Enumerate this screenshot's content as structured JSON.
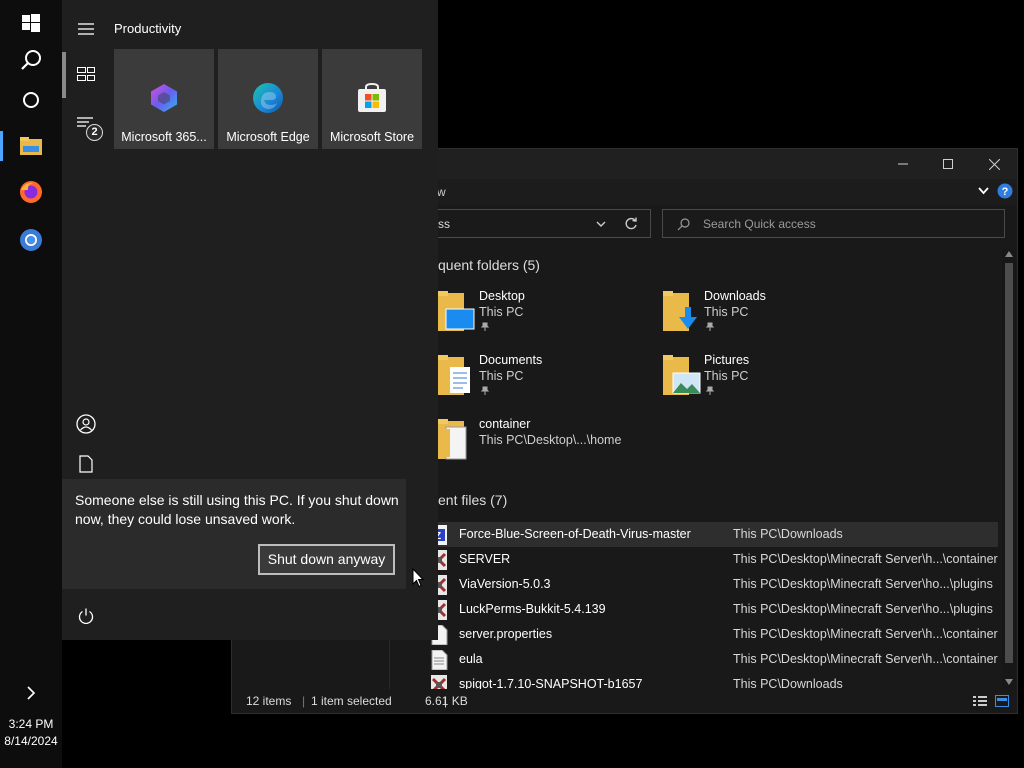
{
  "taskbar": {
    "clock_time": "3:24 PM",
    "clock_date": "8/14/2024"
  },
  "start_menu": {
    "group_title": "Productivity",
    "badge_count": "2",
    "tiles": [
      {
        "label": "Microsoft 365...",
        "icon": "microsoft-365-icon"
      },
      {
        "label": "Microsoft Edge",
        "icon": "edge-icon"
      },
      {
        "label": "Microsoft Store",
        "icon": "store-icon"
      }
    ]
  },
  "notice": {
    "message": "Someone else is still using this PC. If you shut down now, they could lose unsaved work.",
    "button_label": "Shut down anyway"
  },
  "explorer": {
    "ribbon_fragment": "w",
    "address_fragment": "ss",
    "search_placeholder": "Search Quick access",
    "frequent_header": "quent folders (5)",
    "recent_header": "ent files (7)",
    "folders": [
      {
        "name": "Desktop",
        "location": "This PC",
        "pinned": true
      },
      {
        "name": "Downloads",
        "location": "This PC",
        "pinned": true
      },
      {
        "name": "Documents",
        "location": "This PC",
        "pinned": true
      },
      {
        "name": "Pictures",
        "location": "This PC",
        "pinned": true
      },
      {
        "name": "container",
        "location": "This PC\\Desktop\\...\\home",
        "pinned": false
      }
    ],
    "files": [
      {
        "name": "Force-Blue-Screen-of-Death-Virus-master",
        "location": "This PC\\Downloads",
        "selected": true
      },
      {
        "name": "SERVER",
        "location": "This PC\\Desktop\\Minecraft Server\\h...\\container",
        "selected": false
      },
      {
        "name": "ViaVersion-5.0.3",
        "location": "This PC\\Desktop\\Minecraft Server\\ho...\\plugins",
        "selected": false
      },
      {
        "name": "LuckPerms-Bukkit-5.4.139",
        "location": "This PC\\Desktop\\Minecraft Server\\ho...\\plugins",
        "selected": false
      },
      {
        "name": "server.properties",
        "location": "This PC\\Desktop\\Minecraft Server\\h...\\container",
        "selected": false
      },
      {
        "name": "eula",
        "location": "This PC\\Desktop\\Minecraft Server\\h...\\container",
        "selected": false
      },
      {
        "name": "spigot-1.7.10-SNAPSHOT-b1657",
        "location": "This PC\\Downloads",
        "selected": false
      }
    ],
    "status": {
      "items": "12 items",
      "selected": "1 item selected",
      "size": "6.61 KB"
    }
  }
}
